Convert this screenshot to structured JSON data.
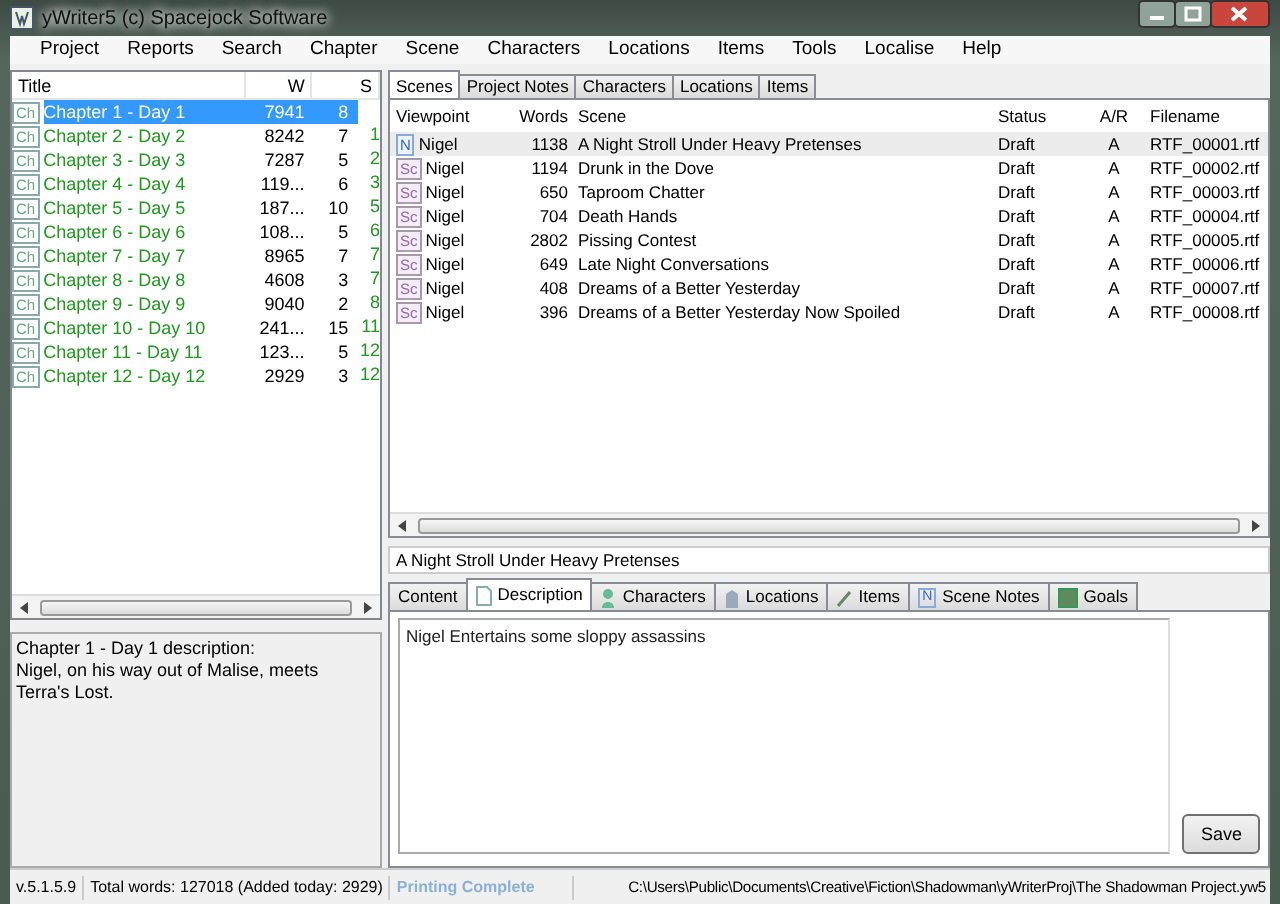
{
  "window": {
    "title": "yWriter5 (c) Spacejock Software"
  },
  "menu": [
    "Project",
    "Reports",
    "Search",
    "Chapter",
    "Scene",
    "Characters",
    "Locations",
    "Items",
    "Tools",
    "Localise",
    "Help"
  ],
  "chapters": {
    "columns": [
      "Title",
      "W",
      "S"
    ],
    "rows": [
      {
        "badge": "Ch",
        "title": "Chapter 1 - Day 1",
        "w": "7941",
        "s": "8",
        "column_4": "",
        "selected": true
      },
      {
        "badge": "Ch",
        "title": "Chapter 2 - Day 2",
        "w": "8242",
        "s": "7",
        "column_4": "1",
        "selected": false
      },
      {
        "badge": "Ch",
        "title": "Chapter 3 - Day 3",
        "w": "7287",
        "s": "5",
        "column_4": "2",
        "selected": false
      },
      {
        "badge": "Ch",
        "title": "Chapter 4 - Day 4",
        "w": "119...",
        "s": "6",
        "column_4": "3",
        "selected": false
      },
      {
        "badge": "Ch",
        "title": "Chapter 5 - Day 5",
        "w": "187...",
        "s": "10",
        "column_4": "5",
        "selected": false
      },
      {
        "badge": "Ch",
        "title": "Chapter 6 - Day 6",
        "w": "108...",
        "s": "5",
        "column_4": "6",
        "selected": false
      },
      {
        "badge": "Ch",
        "title": "Chapter 7 - Day 7",
        "w": "8965",
        "s": "7",
        "column_4": "7",
        "selected": false
      },
      {
        "badge": "Ch",
        "title": "Chapter 8 - Day 8",
        "w": "4608",
        "s": "3",
        "column_4": "7",
        "selected": false
      },
      {
        "badge": "Ch",
        "title": "Chapter 9 - Day 9",
        "w": "9040",
        "s": "2",
        "column_4": "8",
        "selected": false
      },
      {
        "badge": "Ch",
        "title": "Chapter 10 - Day 10",
        "w": "241...",
        "s": "15",
        "column_4": "11",
        "selected": false
      },
      {
        "badge": "Ch",
        "title": "Chapter 11 - Day 11",
        "w": "123...",
        "s": "5",
        "column_4": "12",
        "selected": false
      },
      {
        "badge": "Ch",
        "title": "Chapter 12 - Day 12",
        "w": "2929",
        "s": "3",
        "column_4": "12",
        "selected": false
      }
    ]
  },
  "chapter_description": {
    "heading": "Chapter 1 - Day 1 description:",
    "text": "Nigel, on his way out of Malise, meets Terra's Lost."
  },
  "top_tabs": [
    {
      "label": "Scenes",
      "selected": true
    },
    {
      "label": "Project Notes",
      "selected": false
    },
    {
      "label": "Characters",
      "selected": false
    },
    {
      "label": "Locations",
      "selected": false
    },
    {
      "label": "Items",
      "selected": false
    }
  ],
  "scenes": {
    "columns": [
      "Viewpoint",
      "Words",
      "Scene",
      "Status",
      "A/R",
      "Filename"
    ],
    "rows": [
      {
        "badge": "N",
        "viewpoint": "Nigel",
        "words": "1138",
        "scene": "A Night Stroll Under Heavy Pretenses",
        "status": "Draft",
        "ar": "A",
        "filename": "RTF_00001.rtf",
        "selected": true
      },
      {
        "badge": "Sc",
        "viewpoint": "Nigel",
        "words": "1194",
        "scene": "Drunk in the Dove",
        "status": "Draft",
        "ar": "A",
        "filename": "RTF_00002.rtf",
        "selected": false
      },
      {
        "badge": "Sc",
        "viewpoint": "Nigel",
        "words": "650",
        "scene": "Taproom Chatter",
        "status": "Draft",
        "ar": "A",
        "filename": "RTF_00003.rtf",
        "selected": false
      },
      {
        "badge": "Sc",
        "viewpoint": "Nigel",
        "words": "704",
        "scene": "Death Hands",
        "status": "Draft",
        "ar": "A",
        "filename": "RTF_00004.rtf",
        "selected": false
      },
      {
        "badge": "Sc",
        "viewpoint": "Nigel",
        "words": "2802",
        "scene": "Pissing Contest",
        "status": "Draft",
        "ar": "A",
        "filename": "RTF_00005.rtf",
        "selected": false
      },
      {
        "badge": "Sc",
        "viewpoint": "Nigel",
        "words": "649",
        "scene": "Late Night Conversations",
        "status": "Draft",
        "ar": "A",
        "filename": "RTF_00006.rtf",
        "selected": false
      },
      {
        "badge": "Sc",
        "viewpoint": "Nigel",
        "words": "408",
        "scene": "Dreams of a Better Yesterday",
        "status": "Draft",
        "ar": "A",
        "filename": "RTF_00007.rtf",
        "selected": false
      },
      {
        "badge": "Sc",
        "viewpoint": "Nigel",
        "words": "396",
        "scene": "Dreams of a Better Yesterday Now Spoiled",
        "status": "Draft",
        "ar": "A",
        "filename": "RTF_00008.rtf",
        "selected": false
      }
    ]
  },
  "scene_title": {
    "value": "A Night Stroll Under Heavy Pretenses"
  },
  "scene_tabs": [
    {
      "label": "Content",
      "kind": "plain",
      "selected": false
    },
    {
      "label": "Description",
      "kind": "page",
      "selected": true
    },
    {
      "label": "Characters",
      "kind": "person",
      "selected": false
    },
    {
      "label": "Locations",
      "kind": "building",
      "selected": false
    },
    {
      "label": "Items",
      "kind": "pencil",
      "selected": false
    },
    {
      "label": "Scene Notes",
      "kind": "letter",
      "icon_label": "N",
      "selected": false
    },
    {
      "label": "Goals",
      "kind": "square",
      "selected": false
    }
  ],
  "scene_description": {
    "value": "Nigel Entertains some sloppy assassins"
  },
  "save_button": "Save",
  "status_bar": {
    "version": "v.5.1.5.9",
    "totals": "Total words: 127018 (Added today: 2929)",
    "message": "Printing Complete",
    "path": "C:\\Users\\Public\\Documents\\Creative\\Fiction\\Shadowman\\yWriterProj\\The Shadowman Project.yw5"
  }
}
